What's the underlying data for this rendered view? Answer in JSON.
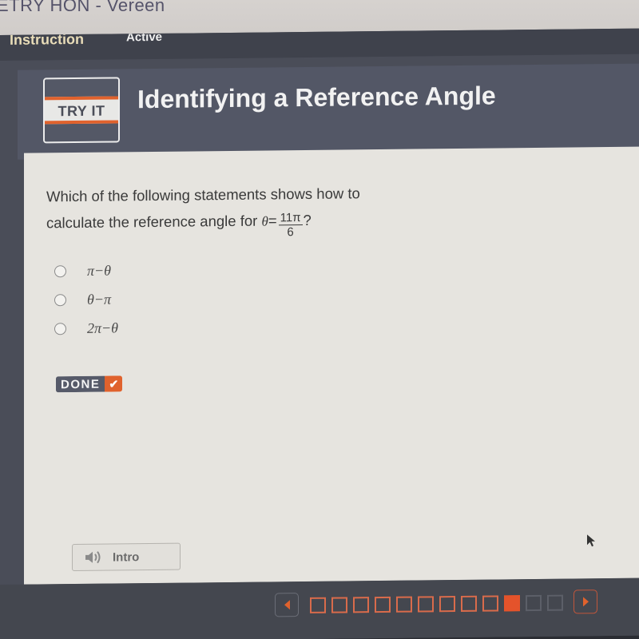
{
  "browser": {
    "title": "ETRY HON - Vereen"
  },
  "tabs": {
    "instruction": "Instruction",
    "active": "Active"
  },
  "header": {
    "badge": "TRY IT",
    "title": "Identifying a Reference Angle"
  },
  "question": {
    "line1": "Which of the following statements shows how to",
    "line2": "calculate the reference angle for",
    "theta_symbol": "θ",
    "equals": "=",
    "numerator": "11π",
    "denominator": "6",
    "end": "?"
  },
  "options": [
    {
      "text": "π−θ",
      "selected": false
    },
    {
      "text": "θ−π",
      "selected": false
    },
    {
      "text": "2π−θ",
      "selected": false
    }
  ],
  "done_button": {
    "label": "DONE",
    "icon": "checkmark-icon"
  },
  "intro_button": {
    "label": "Intro",
    "icon": "speaker-icon"
  },
  "navigation": {
    "total_steps": 12,
    "completed_steps": 9,
    "current_step": 10,
    "accent_color": "#e0622d"
  }
}
